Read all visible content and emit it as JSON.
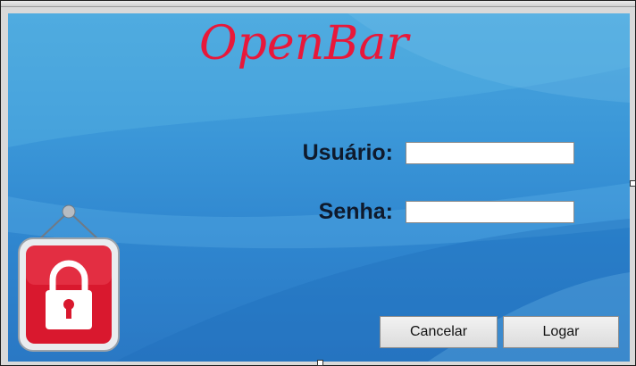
{
  "app": {
    "logo_text": "OpenBar"
  },
  "login_form": {
    "username_label": "Usuário:",
    "username_value": "",
    "password_label": "Senha:",
    "password_value": ""
  },
  "buttons": {
    "cancel_label": "Cancelar",
    "login_label": "Logar"
  },
  "icons": {
    "lock": "padlock-sign-icon"
  },
  "colors": {
    "logo": "#e8183a",
    "background_top": "#4aa6dd",
    "background_bottom": "#2a78c4",
    "lock_red": "#d9182e",
    "label_text": "#0f1a2c"
  }
}
